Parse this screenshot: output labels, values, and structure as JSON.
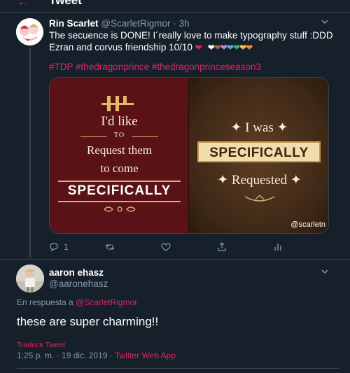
{
  "header": {
    "back_icon": "back-arrow-icon",
    "title": "Tweet"
  },
  "tweet1": {
    "author_name": "Rin Scarlet",
    "author_handle": "@ScarletRigmor",
    "separator": "·",
    "time": "3h",
    "text": "The secuence is DONE! I´really love to make typography stuff :DDD Ezran and corvus friendship 10/10",
    "hearts": [
      "❤",
      "🖤",
      "🤍",
      "🤎",
      "💜",
      "💙",
      "💚",
      "💛",
      "🧡"
    ],
    "heart_colors": [
      "#e0245e",
      "#222222",
      "#ffffff",
      "#b05f3c",
      "#b48ae0",
      "#5aa7ea",
      "#3bb36b",
      "#f5c452",
      "#f08a2a"
    ],
    "hashtags": "#TDP #thedragonprince #thedragonprinceseason3",
    "image_left": {
      "line1": "I'd like",
      "to": "TO",
      "line2": "Request them",
      "line3": "to come",
      "emphasis": "SPECIFICALLY"
    },
    "image_right": {
      "line1": "✦ I was ✦",
      "emphasis": "SPECIFICALLY",
      "line3": "✦ Requested ✦",
      "watermark": "@scarletn"
    },
    "actions": {
      "reply_count": "1"
    },
    "accent_color": "#e0245e"
  },
  "tweet2": {
    "author_name": "aaron ehasz",
    "author_handle": "@aaronehasz",
    "reply_prefix": "En respuesta a",
    "reply_mention": "@ScarletRigmor",
    "text": "these are super charming!!",
    "translate": "Traducir Tweet",
    "timestamp": "1:25 p. m. · 19 dic. 2019 ·",
    "source": "Twitter Web App"
  }
}
